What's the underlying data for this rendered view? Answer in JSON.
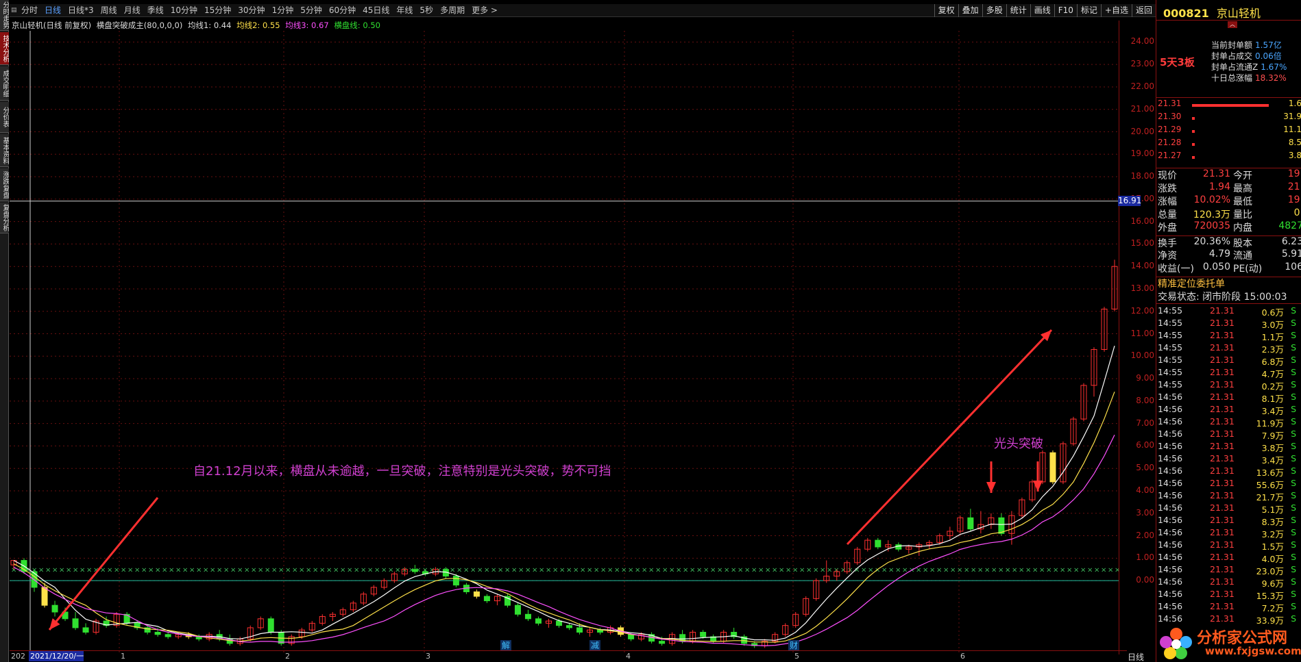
{
  "left_tabs": [
    "分时走势",
    "技术分析",
    "成交明细",
    "分价表",
    "基本资料",
    "涨跌复盘",
    "复盘分析"
  ],
  "toolbar": {
    "periods": [
      "分时",
      "日线",
      "日线*3",
      "周线",
      "月线",
      "季线",
      "10分钟",
      "15分钟",
      "30分钟",
      "1分钟",
      "5分钟",
      "60分钟",
      "45日线",
      "年线",
      "5秒",
      "多周期",
      "更多 >"
    ],
    "active_period": "日线",
    "right_tools": [
      "复权",
      "叠加",
      "多股",
      "统计",
      "画线",
      "F10",
      "标记",
      "+自选",
      "返回"
    ]
  },
  "indicator": {
    "title": "京山轻机(日线 前复权)",
    "formula": "横盘突破成主(80,0,0,0)",
    "ma1": "均线1: 0.44",
    "ma2": "均线2: 0.55",
    "ma3": "均线3: 0.67",
    "hp": "横盘线: 0.50"
  },
  "chart_data": {
    "type": "candlestick",
    "y_ticks": [
      "24.00",
      "23.00",
      "22.00",
      "21.00",
      "20.00",
      "19.00",
      "18.00",
      "17.00",
      "16.00",
      "15.00",
      "14.00",
      "13.00",
      "12.00",
      "11.00",
      "10.00",
      "9.00",
      "8.00",
      "7.00",
      "6.00",
      "5.00",
      "4.00",
      "3.00",
      "2.00",
      "1.00",
      "0.00"
    ],
    "y_range": [
      -3.2,
      24.5
    ],
    "crosshair_price": "16.91",
    "x_labels": [
      "1",
      "2",
      "3",
      "4",
      "5",
      "6"
    ],
    "annotation_text": "自21.12月以来，横盘从未逾越，一旦突破，注意特别是光头突破，势不可挡",
    "annotation_breakout": "光头突破",
    "event_marks": [
      "解",
      "减",
      "财"
    ],
    "colors": {
      "up": "#ff3030",
      "down": "#30e030",
      "ma1": "#ffffff",
      "ma2": "#ffe14a",
      "ma3": "#ff50ff",
      "hline": "#20c0a0",
      "arrow": "#ff3030",
      "annotation": "#d040d0"
    },
    "candles": [
      [
        0.7,
        0.9,
        0.5,
        0.9
      ],
      [
        0.9,
        1.0,
        0.3,
        0.4
      ],
      [
        0.4,
        0.5,
        -0.5,
        -0.3
      ],
      [
        -0.3,
        -0.1,
        -1.2,
        -1.1
      ],
      [
        -1.1,
        -0.9,
        -1.6,
        -1.4
      ],
      [
        -1.4,
        -1.2,
        -1.8,
        -1.7
      ],
      [
        -1.7,
        -1.4,
        -2.2,
        -2.1
      ],
      [
        -2.1,
        -1.9,
        -2.4,
        -2.3
      ],
      [
        -2.3,
        -1.7,
        -2.4,
        -1.8
      ],
      [
        -1.8,
        -1.6,
        -2.1,
        -2.0
      ],
      [
        -2.0,
        -1.4,
        -2.1,
        -1.5
      ],
      [
        -1.5,
        -1.4,
        -2.0,
        -1.9
      ],
      [
        -1.9,
        -1.8,
        -2.2,
        -2.1
      ],
      [
        -2.1,
        -2.0,
        -2.4,
        -2.3
      ],
      [
        -2.3,
        -2.1,
        -2.5,
        -2.4
      ],
      [
        -2.4,
        -2.3,
        -2.6,
        -2.5
      ],
      [
        -2.5,
        -2.3,
        -2.6,
        -2.4
      ],
      [
        -2.4,
        -2.3,
        -2.6,
        -2.5
      ],
      [
        -2.5,
        -2.4,
        -2.7,
        -2.6
      ],
      [
        -2.6,
        -2.3,
        -2.7,
        -2.4
      ],
      [
        -2.4,
        -2.2,
        -2.7,
        -2.6
      ],
      [
        -2.6,
        -2.4,
        -2.9,
        -2.8
      ],
      [
        -2.8,
        -2.5,
        -2.9,
        -2.6
      ],
      [
        -2.6,
        -2.0,
        -2.7,
        -2.1
      ],
      [
        -2.1,
        -1.6,
        -2.2,
        -1.7
      ],
      [
        -1.7,
        -1.6,
        -2.4,
        -2.3
      ],
      [
        -2.3,
        -2.2,
        -2.9,
        -2.8
      ],
      [
        -2.8,
        -2.4,
        -2.9,
        -2.5
      ],
      [
        -2.5,
        -2.1,
        -2.6,
        -2.2
      ],
      [
        -2.2,
        -1.8,
        -2.3,
        -1.9
      ],
      [
        -1.9,
        -1.5,
        -2.0,
        -1.6
      ],
      [
        -1.6,
        -1.4,
        -1.8,
        -1.5
      ],
      [
        -1.5,
        -1.2,
        -1.6,
        -1.3
      ],
      [
        -1.3,
        -0.9,
        -1.4,
        -1.0
      ],
      [
        -1.0,
        -0.5,
        -1.1,
        -0.6
      ],
      [
        -0.6,
        -0.2,
        -0.7,
        -0.3
      ],
      [
        -0.3,
        0.1,
        -0.4,
        0.0
      ],
      [
        0.0,
        0.4,
        -0.1,
        0.3
      ],
      [
        0.3,
        0.6,
        0.2,
        0.5
      ],
      [
        0.5,
        0.7,
        0.3,
        0.4
      ],
      [
        0.4,
        0.5,
        0.2,
        0.3
      ],
      [
        0.3,
        0.6,
        0.2,
        0.5
      ],
      [
        0.5,
        0.6,
        0.1,
        0.2
      ],
      [
        0.2,
        0.3,
        -0.3,
        -0.2
      ],
      [
        -0.2,
        -0.1,
        -0.6,
        -0.5
      ],
      [
        -0.5,
        -0.4,
        -0.8,
        -0.7
      ],
      [
        -0.7,
        -0.6,
        -1.0,
        -0.9
      ],
      [
        -0.9,
        -0.6,
        -1.1,
        -0.7
      ],
      [
        -0.7,
        -0.6,
        -1.2,
        -1.1
      ],
      [
        -1.1,
        -1.0,
        -1.6,
        -1.5
      ],
      [
        -1.5,
        -1.3,
        -1.8,
        -1.7
      ],
      [
        -1.7,
        -1.6,
        -2.0,
        -1.9
      ],
      [
        -1.9,
        -1.7,
        -2.1,
        -1.8
      ],
      [
        -1.8,
        -1.7,
        -2.1,
        -2.0
      ],
      [
        -2.0,
        -1.9,
        -2.2,
        -2.1
      ],
      [
        -2.1,
        -1.9,
        -2.4,
        -2.3
      ],
      [
        -2.3,
        -2.1,
        -2.5,
        -2.2
      ],
      [
        -2.2,
        -2.1,
        -2.4,
        -2.3
      ],
      [
        -2.3,
        -2.0,
        -2.4,
        -2.1
      ],
      [
        -2.1,
        -2.0,
        -2.5,
        -2.4
      ],
      [
        -2.4,
        -2.3,
        -2.7,
        -2.6
      ],
      [
        -2.6,
        -2.3,
        -2.7,
        -2.4
      ],
      [
        -2.4,
        -2.3,
        -2.8,
        -2.7
      ],
      [
        -2.7,
        -2.5,
        -2.9,
        -2.8
      ],
      [
        -2.8,
        -2.3,
        -2.9,
        -2.4
      ],
      [
        -2.4,
        -2.2,
        -2.8,
        -2.7
      ],
      [
        -2.7,
        -2.2,
        -2.8,
        -2.3
      ],
      [
        -2.3,
        -2.2,
        -2.6,
        -2.5
      ],
      [
        -2.5,
        -2.4,
        -2.8,
        -2.7
      ],
      [
        -2.7,
        -2.2,
        -2.8,
        -2.3
      ],
      [
        -2.3,
        -2.1,
        -2.6,
        -2.5
      ],
      [
        -2.5,
        -2.4,
        -2.9,
        -2.8
      ],
      [
        -2.8,
        -2.7,
        -3.0,
        -2.9
      ],
      [
        -2.9,
        -2.6,
        -3.0,
        -2.7
      ],
      [
        -2.7,
        -2.3,
        -2.8,
        -2.4
      ],
      [
        -2.4,
        -1.9,
        -2.5,
        -2.0
      ],
      [
        -2.0,
        -1.4,
        -2.1,
        -1.5
      ],
      [
        -1.5,
        -0.7,
        -1.6,
        -0.8
      ],
      [
        -0.8,
        0.1,
        -0.9,
        0.0
      ],
      [
        0.0,
        0.9,
        -0.1,
        0.2
      ],
      [
        0.2,
        0.5,
        0.0,
        0.4
      ],
      [
        0.4,
        0.9,
        0.3,
        0.8
      ],
      [
        0.8,
        1.5,
        0.7,
        1.4
      ],
      [
        1.4,
        1.9,
        1.3,
        1.8
      ],
      [
        1.8,
        1.9,
        1.4,
        1.5
      ],
      [
        1.5,
        1.8,
        1.3,
        1.6
      ],
      [
        1.6,
        1.7,
        1.3,
        1.4
      ],
      [
        1.4,
        1.6,
        1.2,
        1.5
      ],
      [
        1.5,
        1.7,
        1.1,
        1.6
      ],
      [
        1.6,
        1.8,
        1.4,
        1.7
      ],
      [
        1.7,
        2.1,
        1.6,
        2.0
      ],
      [
        2.0,
        2.4,
        1.8,
        2.2
      ],
      [
        2.2,
        2.9,
        2.1,
        2.8
      ],
      [
        2.8,
        3.2,
        2.2,
        2.3
      ],
      [
        2.3,
        3.1,
        2.1,
        2.5
      ],
      [
        2.5,
        3.0,
        2.3,
        2.8
      ],
      [
        2.8,
        3.0,
        2.0,
        2.1
      ],
      [
        2.1,
        3.1,
        1.6,
        2.9
      ],
      [
        2.9,
        3.7,
        2.8,
        3.6
      ],
      [
        3.6,
        4.5,
        3.5,
        4.4
      ],
      [
        4.4,
        5.8,
        4.3,
        5.7
      ],
      [
        5.7,
        5.8,
        4.3,
        4.4
      ],
      [
        4.4,
        6.2,
        4.3,
        6.1
      ],
      [
        6.1,
        7.3,
        6.0,
        7.2
      ],
      [
        7.2,
        8.8,
        7.1,
        8.7
      ],
      [
        8.7,
        10.4,
        8.2,
        10.3
      ],
      [
        10.3,
        12.2,
        10.2,
        12.1
      ],
      [
        12.1,
        14.3,
        12.0,
        14.0
      ]
    ]
  },
  "stock": {
    "code": "000821",
    "name": "京山轻机"
  },
  "limit": {
    "tag": "5天3板",
    "rows": [
      {
        "label": "当前封单额",
        "value": "1.57亿",
        "cls": ""
      },
      {
        "label": "封单占成交",
        "value": "0.06倍",
        "cls": ""
      },
      {
        "label": "封单占流通Z",
        "value": "1.67%",
        "cls": ""
      },
      {
        "label": "十日总涨幅",
        "value": "18.32%",
        "cls": "red"
      }
    ]
  },
  "order_book": [
    {
      "price": "21.31",
      "bar": 0.8,
      "qty": "1.6"
    },
    {
      "price": "21.30",
      "bar": 0.03,
      "qty": "31.9"
    },
    {
      "price": "21.29",
      "bar": 0.03,
      "qty": "11.1"
    },
    {
      "price": "21.28",
      "bar": 0.03,
      "qty": "8.5"
    },
    {
      "price": "21.27",
      "bar": 0.03,
      "qty": "3.8"
    }
  ],
  "quote": {
    "r1": {
      "l1": "现价",
      "v1": "21.31",
      "l2": "今开",
      "v2": "19."
    },
    "r2": {
      "l1": "涨跌",
      "v1": "1.94",
      "l2": "最高",
      "v2": "21."
    },
    "r3": {
      "l1": "涨幅",
      "v1": "10.02%",
      "l2": "最低",
      "v2": "19."
    },
    "r4": {
      "l1": "总量",
      "v1": "120.3万",
      "l2": "量比",
      "v2": "0."
    },
    "r5": {
      "l1": "外盘",
      "v1": "720035",
      "l2": "内盘",
      "v2": "4827"
    },
    "r6": {
      "l1": "换手",
      "v1": "20.36%",
      "l2": "股本",
      "v2": "6.23"
    },
    "r7": {
      "l1": "净资",
      "v1": "4.79",
      "l2": "流通",
      "v2": "5.91"
    },
    "r8": {
      "l1": "收益(一)",
      "v1": "0.050",
      "l2": "PE(动)",
      "v2": "106"
    }
  },
  "entrust_title": "精准定位委托单",
  "trade_status": "交易状态: 闭市阶段  15:00:03",
  "ticks": [
    [
      "14:55",
      "21.31",
      "0.6万",
      "S"
    ],
    [
      "14:55",
      "21.31",
      "3.0万",
      "S"
    ],
    [
      "14:55",
      "21.31",
      "1.1万",
      "S"
    ],
    [
      "14:55",
      "21.31",
      "2.3万",
      "S"
    ],
    [
      "14:55",
      "21.31",
      "6.8万",
      "S"
    ],
    [
      "14:55",
      "21.31",
      "4.7万",
      "S"
    ],
    [
      "14:55",
      "21.31",
      "0.2万",
      "S"
    ],
    [
      "14:56",
      "21.31",
      "8.1万",
      "S"
    ],
    [
      "14:56",
      "21.31",
      "3.4万",
      "S"
    ],
    [
      "14:56",
      "21.31",
      "11.9万",
      "S"
    ],
    [
      "14:56",
      "21.31",
      "7.9万",
      "S"
    ],
    [
      "14:56",
      "21.31",
      "3.8万",
      "S"
    ],
    [
      "14:56",
      "21.31",
      "3.4万",
      "S"
    ],
    [
      "14:56",
      "21.31",
      "13.6万",
      "S"
    ],
    [
      "14:56",
      "21.31",
      "55.6万",
      "S"
    ],
    [
      "14:56",
      "21.31",
      "21.7万",
      "S"
    ],
    [
      "14:56",
      "21.31",
      "5.1万",
      "S"
    ],
    [
      "14:56",
      "21.31",
      "8.3万",
      "S"
    ],
    [
      "14:56",
      "21.31",
      "3.2万",
      "S"
    ],
    [
      "14:56",
      "21.31",
      "1.5万",
      "S"
    ],
    [
      "14:56",
      "21.31",
      "4.0万",
      "S"
    ],
    [
      "14:56",
      "21.31",
      "23.0万",
      "S"
    ],
    [
      "14:56",
      "21.31",
      "9.6万",
      "S"
    ],
    [
      "14:56",
      "21.31",
      "15.3万",
      "S"
    ],
    [
      "14:56",
      "21.31",
      "7.2万",
      "S"
    ],
    [
      "14:56",
      "21.31",
      "33.9万",
      "S"
    ]
  ],
  "date_cursor": "2021/12/20/一",
  "date_left": "202",
  "period_label": "日线",
  "watermark": {
    "text": "分析家公式网",
    "url": "www.fxjgsw.com"
  }
}
